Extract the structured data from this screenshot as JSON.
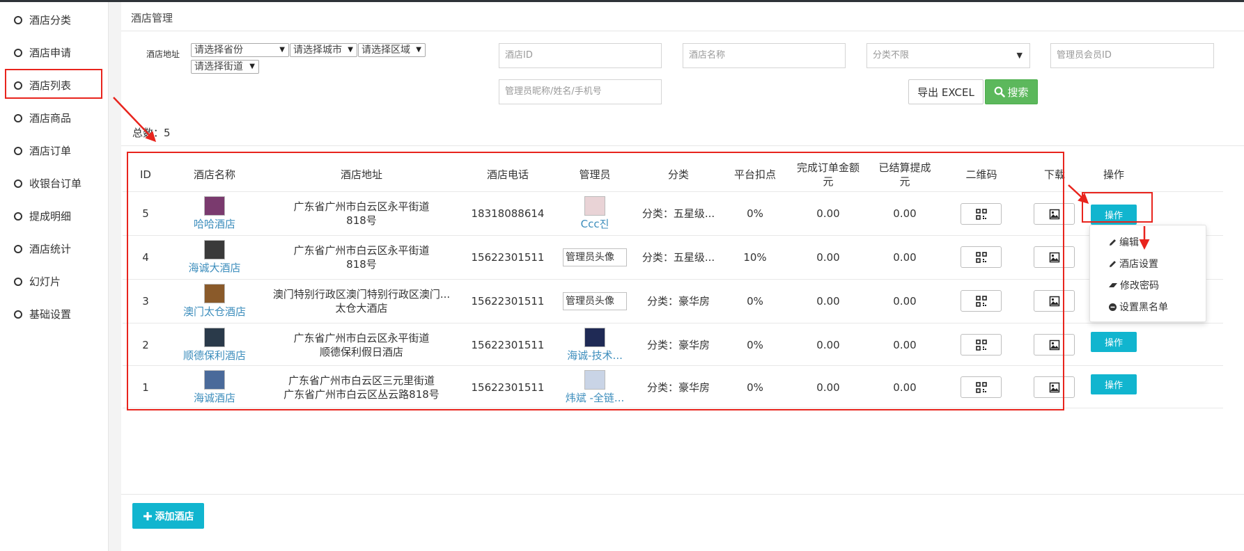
{
  "sidebar": {
    "items": [
      {
        "label": "酒店分类"
      },
      {
        "label": "酒店申请"
      },
      {
        "label": "酒店列表"
      },
      {
        "label": "酒店商品"
      },
      {
        "label": "酒店订单"
      },
      {
        "label": "收银台订单"
      },
      {
        "label": "提成明细"
      },
      {
        "label": "酒店统计"
      },
      {
        "label": "幻灯片"
      },
      {
        "label": "基础设置"
      }
    ]
  },
  "page": {
    "title": "酒店管理"
  },
  "filters": {
    "address_label": "酒店地址",
    "province": "请选择省份",
    "city": "请选择城市",
    "district": "请选择区域",
    "street": "请选择街道",
    "hotel_id_placeholder": "酒店ID",
    "hotel_name_placeholder": "酒店名称",
    "category_select": "分类不限",
    "admin_member_id_placeholder": "管理员会员ID",
    "admin_info_placeholder": "管理员昵称/姓名/手机号",
    "export_label": "导出 EXCEL",
    "search_label": "搜索"
  },
  "summary": {
    "total_label": "总数：",
    "total": "5"
  },
  "table": {
    "headers": {
      "id": "ID",
      "name": "酒店名称",
      "address": "酒店地址",
      "phone": "酒店电话",
      "admin": "管理员",
      "category": "分类",
      "rate": "平台扣点",
      "order_amount_l1": "完成订单金额",
      "order_amount_l2": "元",
      "settled_l1": "已结算提成",
      "settled_l2": "元",
      "qrcode": "二维码",
      "download": "下载",
      "ops": "操作"
    },
    "rows": [
      {
        "id": "5",
        "name": "哈哈酒店",
        "addr1": "广东省广州市白云区永平街道",
        "addr2": "818号",
        "phone": "18318088614",
        "admin": "Ccc진",
        "admin_img": "avatar",
        "category": "分类：五星级...",
        "rate": "0%",
        "amount": "0.00",
        "settled": "0.00",
        "op": "操作",
        "thumb_color": "#7a3a6e"
      },
      {
        "id": "4",
        "name": "海诚大酒店",
        "addr1": "广东省广州市白云区永平街道",
        "addr2": "818号",
        "phone": "15622301511",
        "admin": "",
        "admin_img": "broken",
        "admin_alt": "管理员头像",
        "category": "分类：五星级...",
        "rate": "10%",
        "amount": "0.00",
        "settled": "0.00",
        "op": "操作",
        "thumb_color": "#3a3a3a"
      },
      {
        "id": "3",
        "name": "澳门太仓酒店",
        "addr1": "澳门特别行政区澳门特别行政区澳门...",
        "addr2": "太仓大酒店",
        "phone": "15622301511",
        "admin": "",
        "admin_img": "broken",
        "admin_alt": "管理员头像",
        "category": "分类：豪华房",
        "rate": "0%",
        "amount": "0.00",
        "settled": "0.00",
        "op": "操作",
        "thumb_color": "#8a5a2a"
      },
      {
        "id": "2",
        "name": "顺德保利酒店",
        "addr1": "广东省广州市白云区永平街道",
        "addr2": "顺德保利假日酒店",
        "phone": "15622301511",
        "admin": "海诚-技术...",
        "admin_img": "avatar2",
        "category": "分类：豪华房",
        "rate": "0%",
        "amount": "0.00",
        "settled": "0.00",
        "op": "操作",
        "thumb_color": "#2a3a4a"
      },
      {
        "id": "1",
        "name": "海诚酒店",
        "addr1": "广东省广州市白云区三元里街道",
        "addr2": "广东省广州市白云区丛云路818号",
        "phone": "15622301511",
        "admin": "炜斌 -全链...",
        "admin_img": "avatar3",
        "category": "分类：豪华房",
        "rate": "0%",
        "amount": "0.00",
        "settled": "0.00",
        "op": "操作",
        "thumb_color": "#4a6a9a"
      }
    ]
  },
  "dropdown": {
    "edit": "编辑",
    "hotel_settings": "酒店设置",
    "change_password": "修改密码",
    "set_blacklist": "设置黑名单"
  },
  "footer": {
    "add_label": "添加酒店"
  },
  "colors": {
    "accent": "#11b5cf",
    "search_green": "#5cb85c",
    "annotation_red": "#e8241d",
    "link": "#3c8dbc"
  }
}
